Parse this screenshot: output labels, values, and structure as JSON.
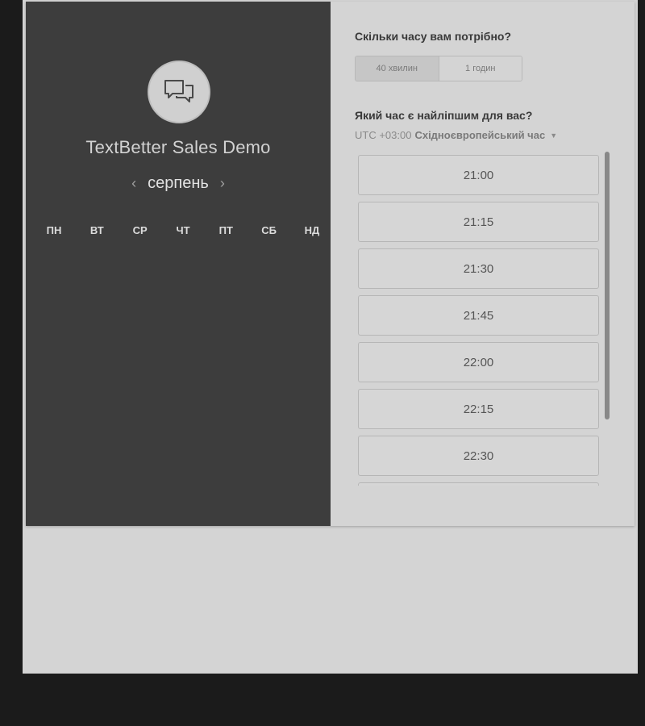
{
  "calendar": {
    "title": "TextBetter Sales Demo",
    "month": "серпень",
    "weekdays": [
      "ПН",
      "ВТ",
      "СР",
      "ЧТ",
      "ПТ",
      "СБ",
      "НД"
    ]
  },
  "duration": {
    "question": "Скільки часу вам потрібно?",
    "options": [
      "40 хвилин",
      "1 годин"
    ],
    "selected": "40 хвилин"
  },
  "time": {
    "question": "Який час є найліпшим для вас?",
    "tz_offset": "UTC +03:00",
    "tz_name": "Східноєвропейський час",
    "slots": [
      "21:00",
      "21:15",
      "21:30",
      "21:45",
      "22:00",
      "22:15",
      "22:30",
      ""
    ]
  },
  "icons": {
    "avatar": "chat-bubbles-icon",
    "prev": "chevron-left-icon",
    "next": "chevron-right-icon",
    "tz_caret": "caret-down-icon"
  },
  "colors": {
    "left_panel": "#3d3d3d",
    "right_panel": "#d4d4d4",
    "page_bg": "#1b1b1b"
  }
}
